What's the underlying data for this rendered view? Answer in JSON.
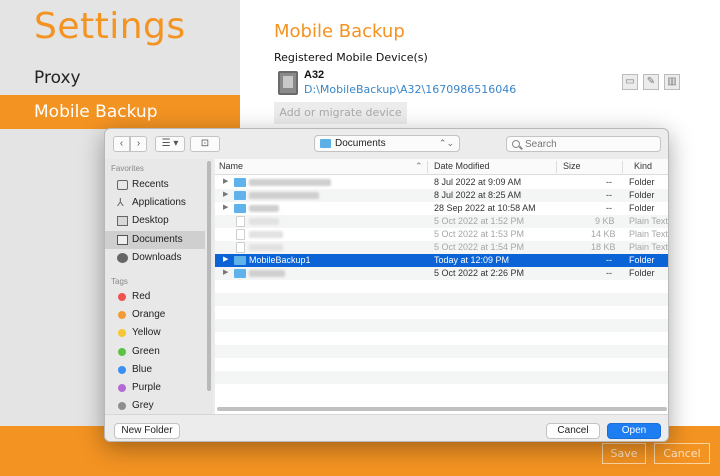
{
  "app": {
    "title": "Settings",
    "sidebar": [
      {
        "label": "Proxy"
      },
      {
        "label": "Mobile Backup",
        "selected": true
      }
    ],
    "accent": "#f39322"
  },
  "main": {
    "title": "Mobile Backup",
    "devices_label": "Registered Mobile Device(s)",
    "device": {
      "name": "A32",
      "path": "D:\\MobileBackup\\A32\\1670986516046"
    },
    "migrate_label": "Add or migrate device"
  },
  "footer": {
    "save_label": "Save",
    "cancel_label": "Cancel"
  },
  "dialog": {
    "location": "Documents",
    "search_placeholder": "Search",
    "favorites_label": "Favorites",
    "favorites": [
      {
        "label": "Recents",
        "icon": "recents-icon"
      },
      {
        "label": "Applications",
        "icon": "applications-icon"
      },
      {
        "label": "Desktop",
        "icon": "desktop-icon"
      },
      {
        "label": "Documents",
        "icon": "documents-icon",
        "selected": true
      },
      {
        "label": "Downloads",
        "icon": "downloads-icon"
      }
    ],
    "tags_label": "Tags",
    "tags": [
      {
        "label": "Red",
        "color": "#f0524f"
      },
      {
        "label": "Orange",
        "color": "#f39a35"
      },
      {
        "label": "Yellow",
        "color": "#f5c731"
      },
      {
        "label": "Green",
        "color": "#5cc346"
      },
      {
        "label": "Blue",
        "color": "#3a8ff2"
      },
      {
        "label": "Purple",
        "color": "#b46ad4"
      },
      {
        "label": "Grey",
        "color": "#8e8e8e"
      }
    ],
    "columns": {
      "name": "Name",
      "date": "Date Modified",
      "size": "Size",
      "kind": "Kind"
    },
    "rows": [
      {
        "name": "",
        "date": "8 Jul 2022 at 9:09 AM",
        "size": "--",
        "kind": "Folder",
        "type": "folder"
      },
      {
        "name": "",
        "date": "8 Jul 2022 at 8:25 AM",
        "size": "--",
        "kind": "Folder",
        "type": "folder"
      },
      {
        "name": "",
        "date": "28 Sep 2022 at 10:58 AM",
        "size": "--",
        "kind": "Folder",
        "type": "folder"
      },
      {
        "name": "",
        "date": "5 Oct 2022 at 1:52 PM",
        "size": "9 KB",
        "kind": "Plain Text",
        "type": "file",
        "dim": true
      },
      {
        "name": "",
        "date": "5 Oct 2022 at 1:53 PM",
        "size": "14 KB",
        "kind": "Plain Text",
        "type": "file",
        "dim": true
      },
      {
        "name": "",
        "date": "5 Oct 2022 at 1:54 PM",
        "size": "18 KB",
        "kind": "Plain Text",
        "type": "file",
        "dim": true
      },
      {
        "name": "MobileBackup1",
        "date": "Today at 12:09 PM",
        "size": "--",
        "kind": "Folder",
        "type": "folder",
        "selected": true
      },
      {
        "name": "",
        "date": "5 Oct 2022 at 2:26 PM",
        "size": "--",
        "kind": "Folder",
        "type": "folder"
      }
    ],
    "new_folder_label": "New Folder",
    "cancel_label": "Cancel",
    "open_label": "Open"
  }
}
